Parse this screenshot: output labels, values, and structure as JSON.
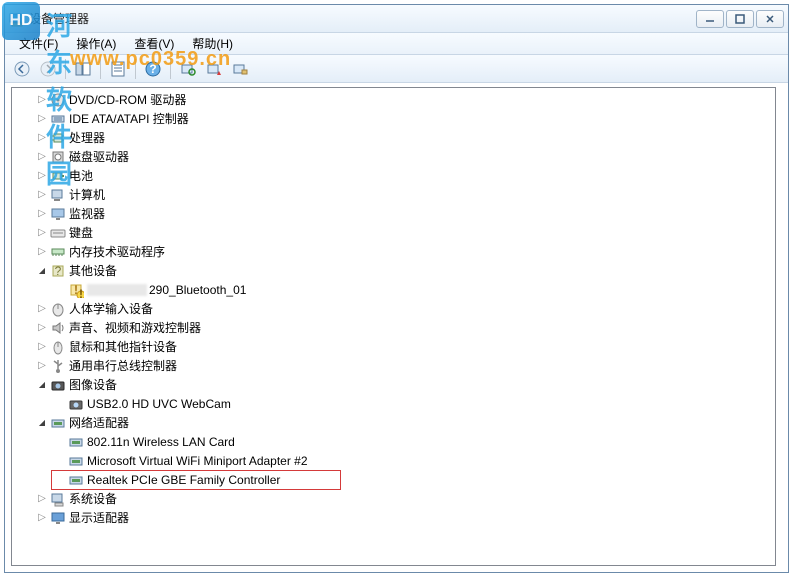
{
  "watermark": {
    "logo_text": "HD",
    "site_name": "河东软件园",
    "url": "www.pc0359.cn"
  },
  "window": {
    "title": "设备管理器",
    "controls": {
      "min": "—",
      "max": "▢",
      "close": "✕"
    }
  },
  "menu": {
    "file": "文件(F)",
    "action": "操作(A)",
    "view": "查看(V)",
    "help": "帮助(H)"
  },
  "tree": {
    "nodes": [
      {
        "label": "DVD/CD-ROM 驱动器",
        "icon": "dvd",
        "expanded": false,
        "depth": 1
      },
      {
        "label": "IDE ATA/ATAPI 控制器",
        "icon": "ide",
        "expanded": false,
        "depth": 1
      },
      {
        "label": "处理器",
        "icon": "cpu",
        "expanded": false,
        "depth": 1
      },
      {
        "label": "磁盘驱动器",
        "icon": "disk",
        "expanded": false,
        "depth": 1
      },
      {
        "label": "电池",
        "icon": "battery",
        "expanded": false,
        "depth": 1
      },
      {
        "label": "计算机",
        "icon": "computer",
        "expanded": false,
        "depth": 1
      },
      {
        "label": "监视器",
        "icon": "monitor",
        "expanded": false,
        "depth": 1
      },
      {
        "label": "键盘",
        "icon": "keyboard",
        "expanded": false,
        "depth": 1
      },
      {
        "label": "内存技术驱动程序",
        "icon": "memory",
        "expanded": false,
        "depth": 1
      },
      {
        "label": "其他设备",
        "icon": "other",
        "expanded": true,
        "depth": 1
      },
      {
        "label": "290_Bluetooth_01",
        "icon": "unknown",
        "expanded": null,
        "depth": 2,
        "warning": true,
        "blurred": true
      },
      {
        "label": "人体学输入设备",
        "icon": "hid",
        "expanded": false,
        "depth": 1
      },
      {
        "label": "声音、视频和游戏控制器",
        "icon": "sound",
        "expanded": false,
        "depth": 1
      },
      {
        "label": "鼠标和其他指针设备",
        "icon": "mouse",
        "expanded": false,
        "depth": 1
      },
      {
        "label": "通用串行总线控制器",
        "icon": "usb",
        "expanded": false,
        "depth": 1
      },
      {
        "label": "图像设备",
        "icon": "imaging",
        "expanded": true,
        "depth": 1
      },
      {
        "label": "USB2.0 HD UVC WebCam",
        "icon": "camera",
        "expanded": null,
        "depth": 2
      },
      {
        "label": "网络适配器",
        "icon": "network",
        "expanded": true,
        "depth": 1
      },
      {
        "label": "802.11n Wireless LAN Card",
        "icon": "netcard",
        "expanded": null,
        "depth": 2
      },
      {
        "label": "Microsoft Virtual WiFi Miniport Adapter #2",
        "icon": "netcard",
        "expanded": null,
        "depth": 2
      },
      {
        "label": "Realtek PCIe GBE Family Controller",
        "icon": "netcard",
        "expanded": null,
        "depth": 2,
        "highlighted": true
      },
      {
        "label": "系统设备",
        "icon": "system",
        "expanded": false,
        "depth": 1
      },
      {
        "label": "显示适配器",
        "icon": "display",
        "expanded": false,
        "depth": 1
      }
    ]
  }
}
